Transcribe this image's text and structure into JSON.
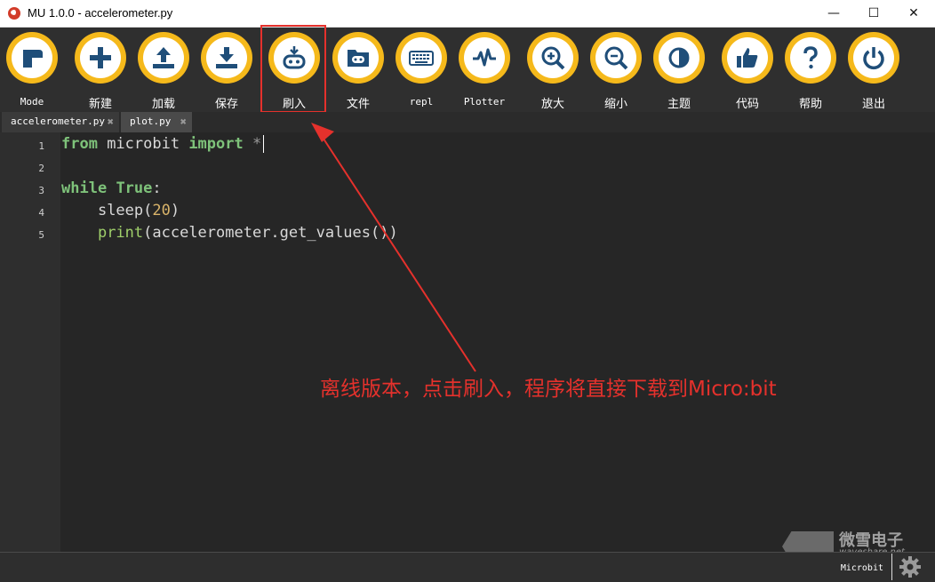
{
  "window": {
    "title": "MU 1.0.0 - accelerometer.py",
    "minimize": "—",
    "maximize": "☐",
    "close": "✕"
  },
  "toolbar": {
    "buttons": [
      {
        "label": "Mode",
        "icon": "mode-icon"
      },
      {
        "label": "新建",
        "icon": "plus-icon"
      },
      {
        "label": "加载",
        "icon": "upload-icon"
      },
      {
        "label": "保存",
        "icon": "download-icon"
      },
      {
        "label": "刷入",
        "icon": "microbit-flash-icon"
      },
      {
        "label": "文件",
        "icon": "files-icon"
      },
      {
        "label": "repl",
        "icon": "keyboard-icon"
      },
      {
        "label": "Plotter",
        "icon": "pulse-icon"
      },
      {
        "label": "放大",
        "icon": "zoom-in-icon"
      },
      {
        "label": "缩小",
        "icon": "zoom-out-icon"
      },
      {
        "label": "主题",
        "icon": "theme-icon"
      },
      {
        "label": "代码",
        "icon": "thumbs-up-icon"
      },
      {
        "label": "帮助",
        "icon": "help-icon"
      },
      {
        "label": "退出",
        "icon": "power-icon"
      }
    ]
  },
  "tabs": [
    {
      "label": "accelerometer.py",
      "close": "✖"
    },
    {
      "label": "plot.py",
      "close": "✖"
    }
  ],
  "editor": {
    "line_numbers": [
      "1",
      "2",
      "3",
      "4",
      "5"
    ],
    "code": {
      "l1_kw1": "from",
      "l1_mod": " microbit ",
      "l1_kw2": "import",
      "l1_star": " *",
      "l3_kw1": "while",
      "l3_sp": " ",
      "l3_true": "True",
      "l3_colon": ":",
      "l4_indent": "    ",
      "l4_fn": "sleep",
      "l4_open": "(",
      "l4_num": "20",
      "l4_close": ")",
      "l5_indent": "    ",
      "l5_fn": "print",
      "l5_rest": "(accelerometer.get_values())"
    }
  },
  "annotation": {
    "text": "离线版本，点击刷入，程序将直接下载到Micro:bit",
    "color": "#e5312c"
  },
  "status": {
    "mode": "Microbit"
  },
  "watermark": {
    "brand_cn": "微雪电子",
    "brand_en": "waveshare.net"
  },
  "colors": {
    "accent_ring": "#f5b91b",
    "icon_blue": "#1f4e79",
    "highlight": "#e5312c"
  }
}
